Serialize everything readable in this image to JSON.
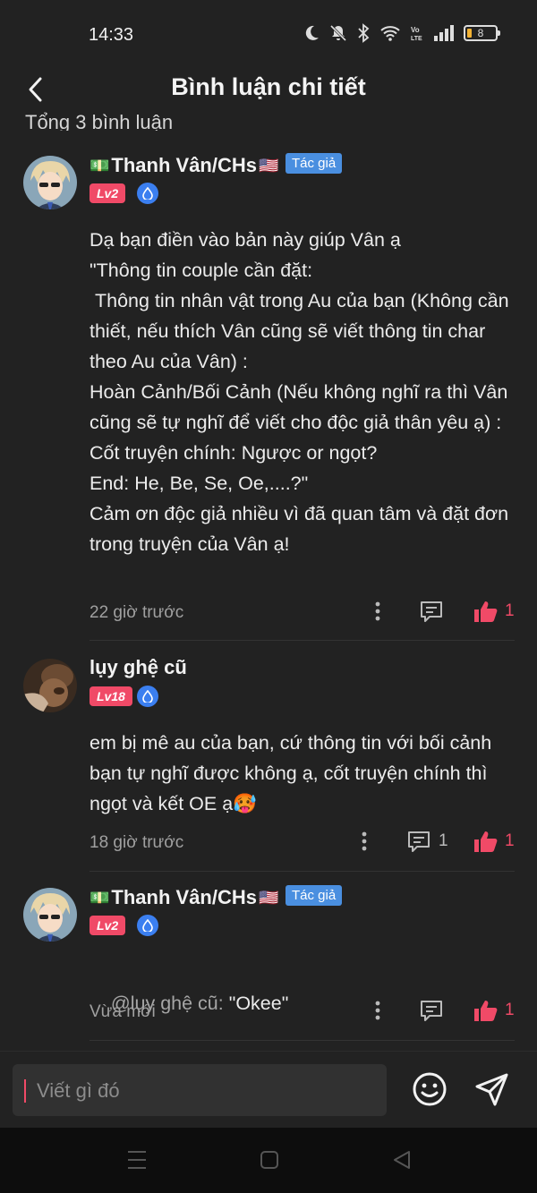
{
  "status_bar": {
    "time": "14:33",
    "battery": "8",
    "icons": [
      "moon-icon",
      "mute-bell-icon",
      "bluetooth-icon",
      "wifi-icon",
      "volte-icon",
      "signal-icon",
      "battery-icon"
    ]
  },
  "header": {
    "title": "Bình luận chi tiết",
    "back_icon": "chevron-left-icon"
  },
  "summary": "Tổng 3 bình luận",
  "comments": [
    {
      "username": "Thanh Vân/CHs",
      "prefix_emoji": "💵",
      "suffix_emoji": "🇺🇸",
      "author_badge": "Tác giả",
      "level": "Lv2",
      "text": "Dạ bạn điền vào bản này giúp Vân ạ\n\"Thông tin couple cần đặt:\n Thông tin nhân vật trong Au của bạn (Không cần thiết, nếu thích Vân cũng sẽ viết thông tin char theo Au của Vân) :\nHoàn Cảnh/Bối Cảnh (Nếu không nghĩ ra thì Vân cũng sẽ tự nghĩ để viết cho độc giả thân yêu ạ) :\nCốt truyện chính: Ngược or ngọt?\nEnd: He, Be, Se, Oe,....?\"\nCảm ơn độc giả nhiều vì đã quan tâm và đặt đơn trong truyện của Vân ạ!",
      "time": "22 giờ trước",
      "reply_count": "",
      "like_count": "1"
    },
    {
      "username": "lụy ghệ cũ",
      "level": "Lv18",
      "text": "em bị mê au của bạn, cứ thông tin với bối cảnh bạn tự nghĩ được không ạ, cốt truyện chính thì ngọt và kết OE ạ🥵",
      "time": "18 giờ trước",
      "reply_count": "1",
      "like_count": "1"
    },
    {
      "username": "Thanh Vân/CHs",
      "prefix_emoji": "💵",
      "suffix_emoji": "🇺🇸",
      "author_badge": "Tác giả",
      "level": "Lv2",
      "mention": "@lụy ghệ cũ:",
      "text": " \"Okee\"",
      "time": "Vừa mới",
      "reply_count": "",
      "like_count": "1"
    }
  ],
  "input": {
    "placeholder": "Viết gì đó"
  },
  "colors": {
    "background": "#222222",
    "accent_pink": "#f04a67",
    "author_blue": "#4a8fe0"
  }
}
